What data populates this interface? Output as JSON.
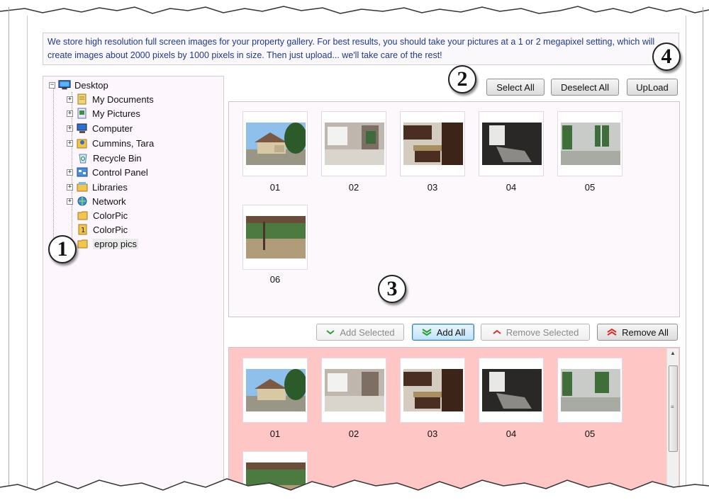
{
  "info_text": "We store high resolution full screen images for your property gallery. For best results, you should take your pictures at a 1 or 2 megapixel setting, which will create images about 2000 pixels by 1000 pixels in size. Then just upload... we'll take care of the rest!",
  "tree": {
    "root": "Desktop",
    "items": [
      {
        "label": "My Documents",
        "icon": "documents-icon",
        "expandable": true
      },
      {
        "label": "My Pictures",
        "icon": "pictures-icon",
        "expandable": true
      },
      {
        "label": "Computer",
        "icon": "computer-icon",
        "expandable": true
      },
      {
        "label": "Cummins, Tara",
        "icon": "user-folder-icon",
        "expandable": true
      },
      {
        "label": "Recycle Bin",
        "icon": "recycle-bin-icon",
        "expandable": false
      },
      {
        "label": "Control Panel",
        "icon": "control-panel-icon",
        "expandable": true
      },
      {
        "label": "Libraries",
        "icon": "libraries-icon",
        "expandable": true
      },
      {
        "label": "Network",
        "icon": "network-icon",
        "expandable": true
      },
      {
        "label": "ColorPic",
        "icon": "folder-icon",
        "expandable": false
      },
      {
        "label": "ColorPic",
        "icon": "colorpic-app-icon",
        "expandable": false
      },
      {
        "label": "eprop pics",
        "icon": "folder-icon",
        "expandable": false,
        "selected": true
      }
    ]
  },
  "toolbar": {
    "select_all": "Select All",
    "deselect_all": "Deselect All",
    "upload": "UpLoad"
  },
  "transfer": {
    "add_selected": "Add Selected",
    "add_all": "Add All",
    "remove_selected": "Remove Selected",
    "remove_all": "Remove All"
  },
  "source_images": [
    "01",
    "02",
    "03",
    "04",
    "05",
    "06"
  ],
  "selected_images": [
    "01",
    "02",
    "03",
    "04",
    "05"
  ],
  "callouts": [
    "1",
    "2",
    "3",
    "4"
  ],
  "colors": {
    "info_text": "#1f3a8a",
    "selected_panel_bg": "#ffc6c6",
    "add_arrow": "#2e9b3a",
    "remove_arrow": "#d0342c"
  }
}
